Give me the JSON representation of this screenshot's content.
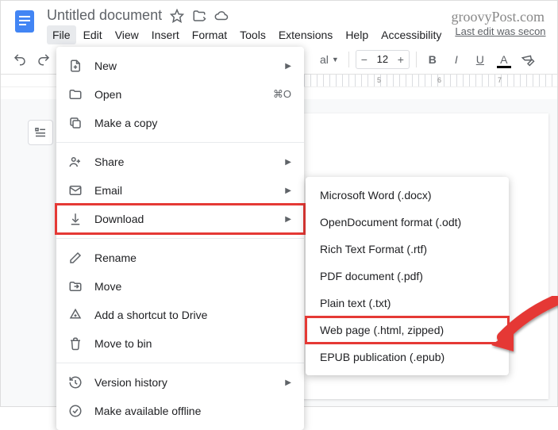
{
  "brand": "groovyPost.com",
  "doc": {
    "title": "Untitled document"
  },
  "last_edit": "Last edit was secon",
  "menubar": [
    "File",
    "Edit",
    "View",
    "Insert",
    "Format",
    "Tools",
    "Extensions",
    "Help",
    "Accessibility"
  ],
  "toolbar": {
    "styles": "al",
    "font_size": "12"
  },
  "file_menu": {
    "new": "New",
    "open": "Open",
    "open_sc": "⌘O",
    "copy": "Make a copy",
    "share": "Share",
    "email": "Email",
    "download": "Download",
    "rename": "Rename",
    "move": "Move",
    "shortcut": "Add a shortcut to Drive",
    "trash": "Move to bin",
    "version": "Version history",
    "offline": "Make available offline"
  },
  "download_menu": {
    "docx": "Microsoft Word (.docx)",
    "odt": "OpenDocument format (.odt)",
    "rtf": "Rich Text Format (.rtf)",
    "pdf": "PDF document (.pdf)",
    "txt": "Plain text (.txt)",
    "html": "Web page (.html, zipped)",
    "epub": "EPUB publication (.epub)"
  }
}
